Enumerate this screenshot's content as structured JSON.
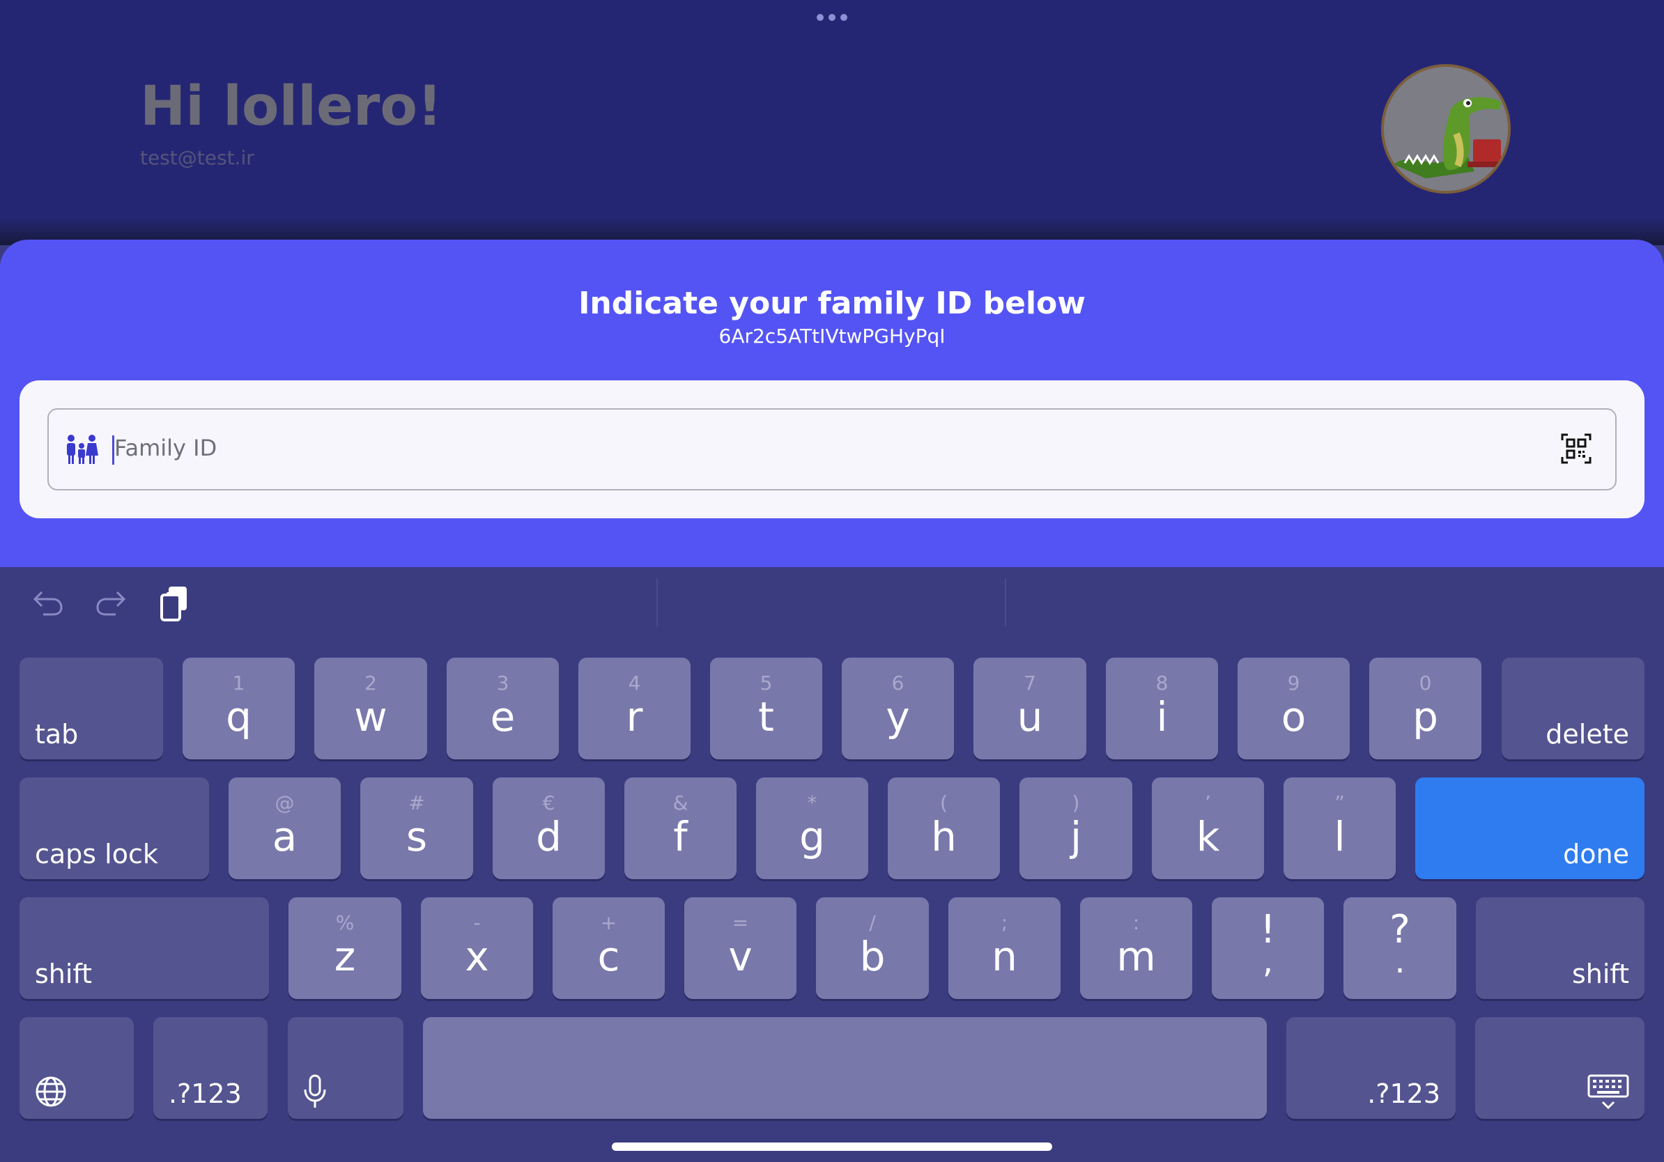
{
  "header": {
    "greeting": "Hi lollero!",
    "email": "test@test.ir",
    "avatar": "crocodile-avatar"
  },
  "sheet": {
    "title": "Indicate your family ID below",
    "family_code": "6Ar2c5ATtIVtwPGHyPqI",
    "field": {
      "placeholder": "Family ID",
      "leading_icon": "family-icon",
      "trailing_icon": "qr-scan-icon"
    }
  },
  "keyboard": {
    "toolbar": [
      "undo-icon",
      "redo-icon",
      "paste-icon"
    ],
    "row1": {
      "tab": "tab",
      "keys": [
        {
          "hint": "1",
          "key": "q"
        },
        {
          "hint": "2",
          "key": "w"
        },
        {
          "hint": "3",
          "key": "e"
        },
        {
          "hint": "4",
          "key": "r"
        },
        {
          "hint": "5",
          "key": "t"
        },
        {
          "hint": "6",
          "key": "y"
        },
        {
          "hint": "7",
          "key": "u"
        },
        {
          "hint": "8",
          "key": "i"
        },
        {
          "hint": "9",
          "key": "o"
        },
        {
          "hint": "0",
          "key": "p"
        }
      ],
      "delete": "delete"
    },
    "row2": {
      "caps": "caps lock",
      "keys": [
        {
          "hint": "@",
          "key": "a"
        },
        {
          "hint": "#",
          "key": "s"
        },
        {
          "hint": "€",
          "key": "d"
        },
        {
          "hint": "&",
          "key": "f"
        },
        {
          "hint": "*",
          "key": "g"
        },
        {
          "hint": "(",
          "key": "h"
        },
        {
          "hint": ")",
          "key": "j"
        },
        {
          "hint": "’",
          "key": "k"
        },
        {
          "hint": "”",
          "key": "l"
        }
      ],
      "done": "done"
    },
    "row3": {
      "shift_left": "shift",
      "keys": [
        {
          "hint": "%",
          "key": "z"
        },
        {
          "hint": "-",
          "key": "x"
        },
        {
          "hint": "+",
          "key": "c"
        },
        {
          "hint": "=",
          "key": "v"
        },
        {
          "hint": "/",
          "key": "b"
        },
        {
          "hint": ";",
          "key": "n"
        },
        {
          "hint": ":",
          "key": "m"
        }
      ],
      "punct": [
        {
          "top": "!",
          "bottom": ","
        },
        {
          "top": "?",
          "bottom": "."
        }
      ],
      "shift_right": "shift"
    },
    "row4": {
      "globe": "globe-icon",
      "numbers_left": ".?123",
      "mic": "microphone-icon",
      "numbers_right": ".?123",
      "dismiss": "keyboard-dismiss-icon"
    }
  },
  "colors": {
    "header_bg": "#252673",
    "sheet_bg": "#5454f5",
    "keyboard_bg": "#3b3b80",
    "done_key": "#2e7cf0"
  }
}
